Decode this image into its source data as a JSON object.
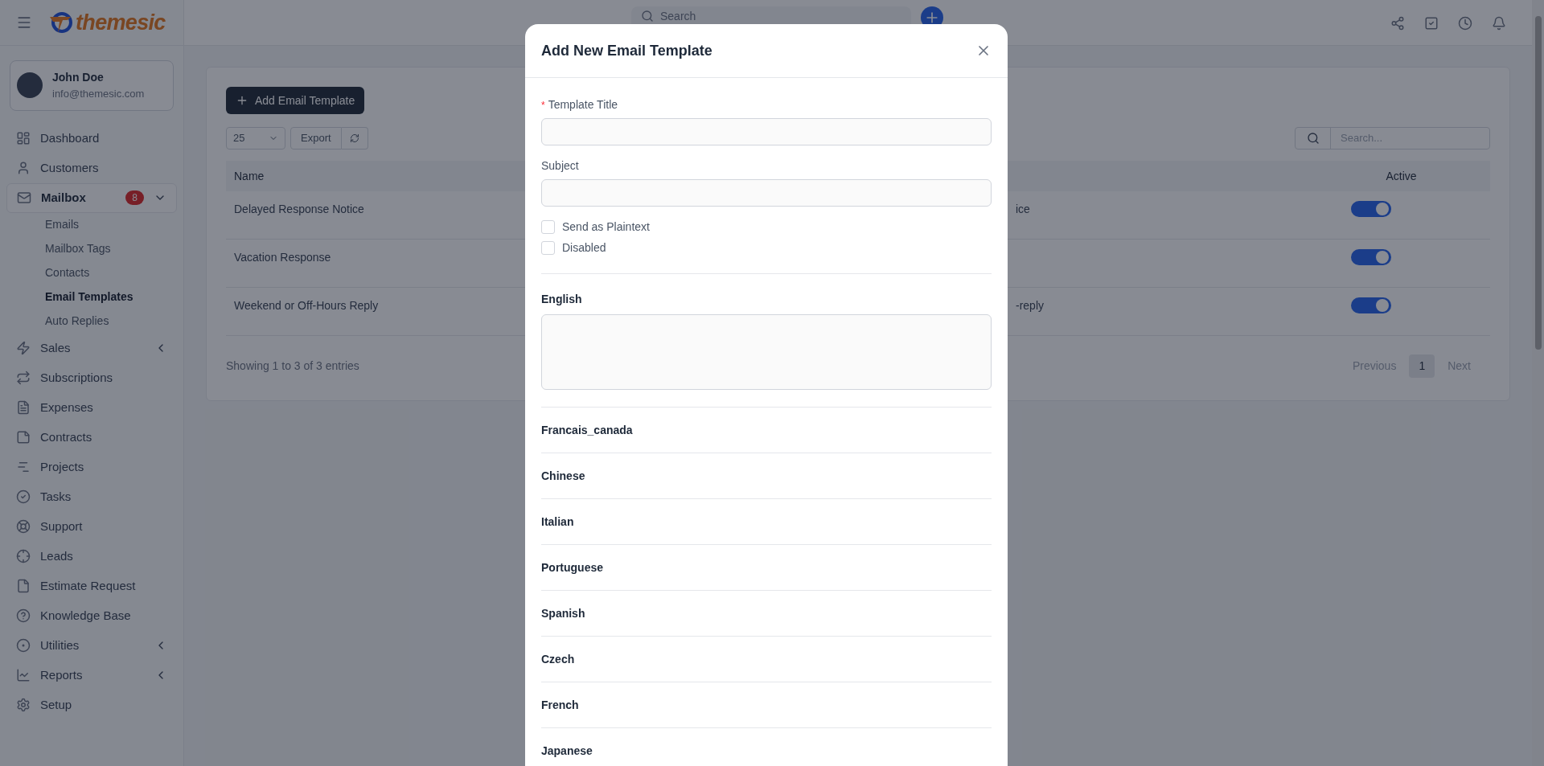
{
  "header": {
    "logo_text": "themesic",
    "search_placeholder": "Search"
  },
  "user": {
    "name": "John Doe",
    "email": "info@themesic.com"
  },
  "sidebar": {
    "items": [
      {
        "label": "Dashboard",
        "selected": false
      },
      {
        "label": "Customers",
        "selected": false
      },
      {
        "label": "Mailbox",
        "selected": true,
        "badge": "8",
        "expanded": true,
        "children": [
          {
            "label": "Emails",
            "selected": false
          },
          {
            "label": "Mailbox Tags",
            "selected": false
          },
          {
            "label": "Contacts",
            "selected": false
          },
          {
            "label": "Email Templates",
            "selected": true
          },
          {
            "label": "Auto Replies",
            "selected": false
          }
        ]
      },
      {
        "label": "Sales",
        "selected": false,
        "expanded": false
      },
      {
        "label": "Subscriptions",
        "selected": false
      },
      {
        "label": "Expenses",
        "selected": false
      },
      {
        "label": "Contracts",
        "selected": false
      },
      {
        "label": "Projects",
        "selected": false
      },
      {
        "label": "Tasks",
        "selected": false
      },
      {
        "label": "Support",
        "selected": false
      },
      {
        "label": "Leads",
        "selected": false
      },
      {
        "label": "Estimate Request",
        "selected": false
      },
      {
        "label": "Knowledge Base",
        "selected": false
      },
      {
        "label": "Utilities",
        "selected": false,
        "expanded": false
      },
      {
        "label": "Reports",
        "selected": false,
        "expanded": false
      },
      {
        "label": "Setup",
        "selected": false
      }
    ]
  },
  "toolbar": {
    "add_button": "Add Email Template",
    "page_size": "25",
    "export": "Export",
    "search_placeholder": "Search..."
  },
  "table": {
    "columns": [
      "Name",
      "Active"
    ],
    "rows": [
      {
        "name": "Delayed Response Notice",
        "column_2": "ice",
        "active": true
      },
      {
        "name": "Vacation Response",
        "active": true
      },
      {
        "name": "Weekend or Off-Hours Reply",
        "column_2": "-reply",
        "active": true
      }
    ]
  },
  "footer": {
    "info": "Showing 1 to 3 of 3 entries",
    "previous": "Previous",
    "next": "Next",
    "pages": [
      {
        "label": "1",
        "selected": true
      }
    ]
  },
  "modal": {
    "title": "Add New Email Template",
    "fields": [
      {
        "label": "Template Title",
        "required_mark": "*"
      },
      {
        "label": "Subject"
      }
    ],
    "checkboxes": [
      {
        "label": "Send as Plaintext",
        "checked": false
      },
      {
        "label": "Disabled",
        "checked": false
      }
    ],
    "editor_label": "English",
    "languages": [
      "Francais_canada",
      "Chinese",
      "Italian",
      "Portuguese",
      "Spanish",
      "Czech",
      "French",
      "Japanese"
    ]
  }
}
